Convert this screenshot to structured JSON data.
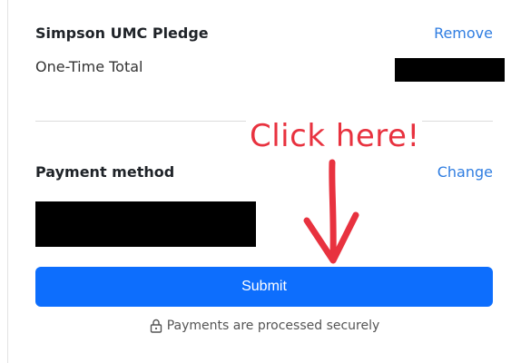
{
  "pledge": {
    "title": "Simpson UMC Pledge",
    "remove_label": "Remove",
    "total_label": "One-Time Total"
  },
  "annotation": {
    "text": "Click here!",
    "color": "#e8323f"
  },
  "payment": {
    "label": "Payment method",
    "change_label": "Change"
  },
  "submit": {
    "label": "Submit",
    "color": "#0d6efd"
  },
  "footer": {
    "secure_text": "Payments are processed securely",
    "icon": "lock-icon"
  },
  "colors": {
    "link": "#2f7de1",
    "heading": "#1f2328"
  }
}
